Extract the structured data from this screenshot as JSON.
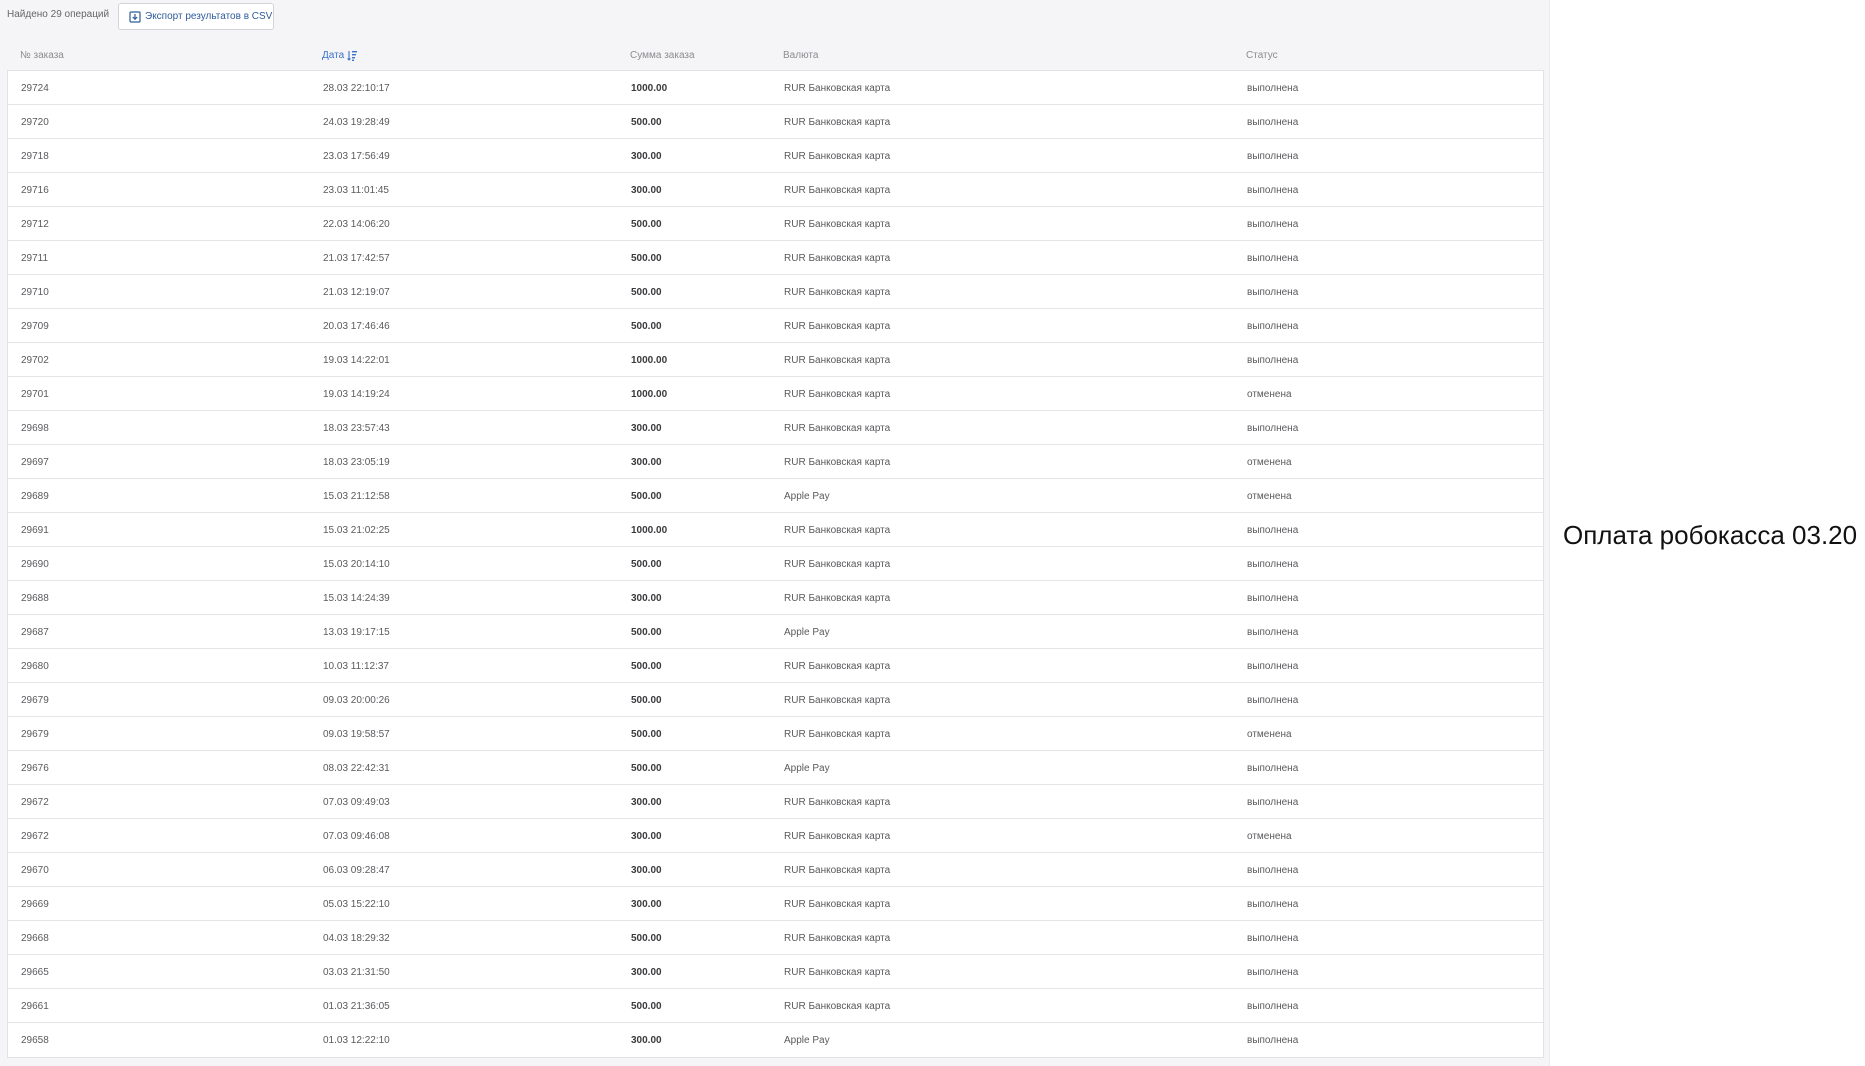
{
  "toolbar": {
    "found_text": "Найдено 29 операций",
    "export_label": "Экспорт результатов в CSV",
    "export_icon": "download-icon"
  },
  "table": {
    "columns": {
      "order_no": "№ заказа",
      "date": "Дата",
      "sum": "Сумма заказа",
      "currency": "Валюта",
      "status": "Статус"
    },
    "sorted_by": "date",
    "sort_icon": "sort-descending-icon",
    "rows": [
      {
        "id": "29724",
        "date": "28.03 22:10:17",
        "sum": "1000.00",
        "currency": "RUR Банковская карта",
        "status": "выполнена"
      },
      {
        "id": "29720",
        "date": "24.03 19:28:49",
        "sum": "500.00",
        "currency": "RUR Банковская карта",
        "status": "выполнена"
      },
      {
        "id": "29718",
        "date": "23.03 17:56:49",
        "sum": "300.00",
        "currency": "RUR Банковская карта",
        "status": "выполнена"
      },
      {
        "id": "29716",
        "date": "23.03 11:01:45",
        "sum": "300.00",
        "currency": "RUR Банковская карта",
        "status": "выполнена"
      },
      {
        "id": "29712",
        "date": "22.03 14:06:20",
        "sum": "500.00",
        "currency": "RUR Банковская карта",
        "status": "выполнена"
      },
      {
        "id": "29711",
        "date": "21.03 17:42:57",
        "sum": "500.00",
        "currency": "RUR Банковская карта",
        "status": "выполнена"
      },
      {
        "id": "29710",
        "date": "21.03 12:19:07",
        "sum": "500.00",
        "currency": "RUR Банковская карта",
        "status": "выполнена"
      },
      {
        "id": "29709",
        "date": "20.03 17:46:46",
        "sum": "500.00",
        "currency": "RUR Банковская карта",
        "status": "выполнена"
      },
      {
        "id": "29702",
        "date": "19.03 14:22:01",
        "sum": "1000.00",
        "currency": "RUR Банковская карта",
        "status": "выполнена"
      },
      {
        "id": "29701",
        "date": "19.03 14:19:24",
        "sum": "1000.00",
        "currency": "RUR Банковская карта",
        "status": "отменена"
      },
      {
        "id": "29698",
        "date": "18.03 23:57:43",
        "sum": "300.00",
        "currency": "RUR Банковская карта",
        "status": "выполнена"
      },
      {
        "id": "29697",
        "date": "18.03 23:05:19",
        "sum": "300.00",
        "currency": "RUR Банковская карта",
        "status": "отменена"
      },
      {
        "id": "29689",
        "date": "15.03 21:12:58",
        "sum": "500.00",
        "currency": "Apple Pay",
        "status": "отменена"
      },
      {
        "id": "29691",
        "date": "15.03 21:02:25",
        "sum": "1000.00",
        "currency": "RUR Банковская карта",
        "status": "выполнена"
      },
      {
        "id": "29690",
        "date": "15.03 20:14:10",
        "sum": "500.00",
        "currency": "RUR Банковская карта",
        "status": "выполнена"
      },
      {
        "id": "29688",
        "date": "15.03 14:24:39",
        "sum": "300.00",
        "currency": "RUR Банковская карта",
        "status": "выполнена"
      },
      {
        "id": "29687",
        "date": "13.03 19:17:15",
        "sum": "500.00",
        "currency": "Apple Pay",
        "status": "выполнена"
      },
      {
        "id": "29680",
        "date": "10.03 11:12:37",
        "sum": "500.00",
        "currency": "RUR Банковская карта",
        "status": "выполнена"
      },
      {
        "id": "29679",
        "date": "09.03 20:00:26",
        "sum": "500.00",
        "currency": "RUR Банковская карта",
        "status": "выполнена"
      },
      {
        "id": "29679",
        "date": "09.03 19:58:57",
        "sum": "500.00",
        "currency": "RUR Банковская карта",
        "status": "отменена"
      },
      {
        "id": "29676",
        "date": "08.03 22:42:31",
        "sum": "500.00",
        "currency": "Apple Pay",
        "status": "выполнена"
      },
      {
        "id": "29672",
        "date": "07.03 09:49:03",
        "sum": "300.00",
        "currency": "RUR Банковская карта",
        "status": "выполнена"
      },
      {
        "id": "29672",
        "date": "07.03 09:46:08",
        "sum": "300.00",
        "currency": "RUR Банковская карта",
        "status": "отменена"
      },
      {
        "id": "29670",
        "date": "06.03 09:28:47",
        "sum": "300.00",
        "currency": "RUR Банковская карта",
        "status": "выполнена"
      },
      {
        "id": "29669",
        "date": "05.03 15:22:10",
        "sum": "300.00",
        "currency": "RUR Банковская карта",
        "status": "выполнена"
      },
      {
        "id": "29668",
        "date": "04.03 18:29:32",
        "sum": "500.00",
        "currency": "RUR Банковская карта",
        "status": "выполнена"
      },
      {
        "id": "29665",
        "date": "03.03 21:31:50",
        "sum": "300.00",
        "currency": "RUR Банковская карта",
        "status": "выполнена"
      },
      {
        "id": "29661",
        "date": "01.03 21:36:05",
        "sum": "500.00",
        "currency": "RUR Банковская карта",
        "status": "выполнена"
      },
      {
        "id": "29658",
        "date": "01.03 12:22:10",
        "sum": "300.00",
        "currency": "Apple Pay",
        "status": "выполнена"
      }
    ]
  },
  "side_caption": "Оплата робокасса 03.20",
  "colors": {
    "accent": "#3a73c8",
    "link": "#2f5c9a",
    "panel_bg": "#f5f5f7"
  }
}
